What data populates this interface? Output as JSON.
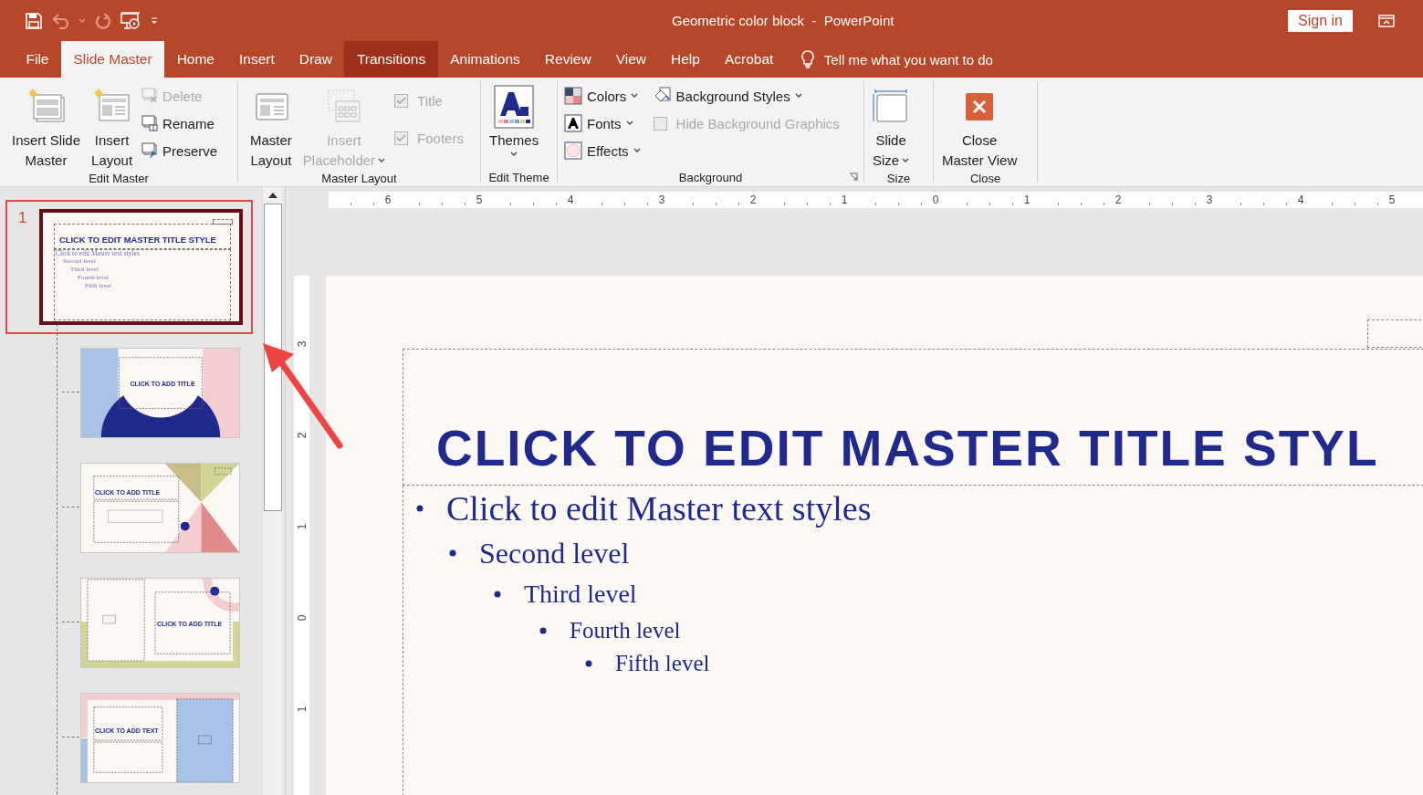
{
  "title_bar": {
    "document_title": "Geometric color block  -  PowerPoint",
    "sign_in": "Sign in"
  },
  "tabs": [
    {
      "label": "File",
      "selected": false,
      "hovered": false
    },
    {
      "label": "Slide Master",
      "selected": true,
      "hovered": false
    },
    {
      "label": "Home",
      "selected": false,
      "hovered": false
    },
    {
      "label": "Insert",
      "selected": false,
      "hovered": false
    },
    {
      "label": "Draw",
      "selected": false,
      "hovered": false
    },
    {
      "label": "Transitions",
      "selected": false,
      "hovered": true
    },
    {
      "label": "Animations",
      "selected": false,
      "hovered": false
    },
    {
      "label": "Review",
      "selected": false,
      "hovered": false
    },
    {
      "label": "View",
      "selected": false,
      "hovered": false
    },
    {
      "label": "Help",
      "selected": false,
      "hovered": false
    },
    {
      "label": "Acrobat",
      "selected": false,
      "hovered": false
    }
  ],
  "tell_me": {
    "label": "Tell me what you want to do"
  },
  "ribbon": {
    "groups": [
      {
        "label": "Edit Master",
        "launcher": false,
        "items": [
          {
            "kind": "large",
            "lines": [
              "Insert Slide",
              "Master"
            ],
            "disabled": false,
            "dropdown": false
          },
          {
            "kind": "large",
            "lines": [
              "Insert",
              "Layout"
            ],
            "disabled": false,
            "dropdown": false
          },
          {
            "kind": "column",
            "items": [
              {
                "kind": "small",
                "label": "Delete",
                "disabled": true,
                "dropdown": false
              },
              {
                "kind": "small",
                "label": "Rename",
                "disabled": false,
                "dropdown": false
              },
              {
                "kind": "small",
                "label": "Preserve",
                "disabled": false,
                "dropdown": false
              }
            ]
          }
        ]
      },
      {
        "label": "Master Layout",
        "launcher": false,
        "items": [
          {
            "kind": "large",
            "lines": [
              "Master",
              "Layout"
            ],
            "disabled": false,
            "dropdown": false
          },
          {
            "kind": "large",
            "lines": [
              "Insert",
              "Placeholder"
            ],
            "disabled": true,
            "dropdown": true
          },
          {
            "kind": "column",
            "items": [
              {
                "kind": "check",
                "label": "Title",
                "disabled": true,
                "checked": true
              },
              {
                "kind": "check",
                "label": "Footers",
                "disabled": true,
                "checked": true
              }
            ]
          }
        ]
      },
      {
        "label": "Edit Theme",
        "launcher": false,
        "items": [
          {
            "kind": "large",
            "lines": [
              "Themes"
            ],
            "disabled": false,
            "dropdown": true
          }
        ]
      },
      {
        "label": "Background",
        "launcher": true,
        "items": [
          {
            "kind": "column",
            "items": [
              {
                "kind": "small",
                "label": "Colors",
                "disabled": false,
                "dropdown": true
              },
              {
                "kind": "small",
                "label": "Fonts",
                "disabled": false,
                "dropdown": true
              },
              {
                "kind": "small",
                "label": "Effects",
                "disabled": false,
                "dropdown": true
              }
            ]
          },
          {
            "kind": "column",
            "items": [
              {
                "kind": "small",
                "label": "Background Styles",
                "disabled": false,
                "dropdown": true
              },
              {
                "kind": "check",
                "label": "Hide Background Graphics",
                "disabled": true,
                "checked": false
              }
            ]
          }
        ]
      },
      {
        "label": "Size",
        "launcher": false,
        "items": [
          {
            "kind": "large",
            "lines": [
              "Slide",
              "Size"
            ],
            "disabled": false,
            "dropdown": true
          }
        ]
      },
      {
        "label": "Close",
        "launcher": false,
        "items": [
          {
            "kind": "large",
            "lines": [
              "Close",
              "Master View"
            ],
            "disabled": false,
            "dropdown": false
          }
        ]
      }
    ]
  },
  "slide_pane": {
    "master": {
      "number": "1",
      "selected": true,
      "title": "CLICK TO EDIT MASTER TITLE STYLE",
      "levels": [
        "Click to edit Master text styles",
        "Second level",
        "Third level",
        "Fourth level",
        "Fifth level"
      ],
      "children": [
        {
          "kind": "circle",
          "title": "CLICK TO ADD TITLE",
          "selected": false
        },
        {
          "kind": "triangles",
          "title": "CLICK TO ADD TITLE",
          "selected": false
        },
        {
          "kind": "ring",
          "title": "CLICK TO ADD TITLE",
          "selected": false
        },
        {
          "kind": "split",
          "title": "CLICK TO ADD TEXT",
          "selected": false
        }
      ]
    }
  },
  "editor": {
    "horizontal_ruler": [
      "6",
      "5",
      "4",
      "3",
      "2",
      "1",
      "0",
      "1",
      "2",
      "3",
      "4",
      "5"
    ],
    "vertical_ruler": [
      "3",
      "2",
      "1",
      "0",
      "1"
    ],
    "slide": {
      "title": "CLICK TO EDIT MASTER TITLE STYL",
      "levels": [
        "Click to edit Master text styles",
        "Second level",
        "Third level",
        "Fourth level",
        "Fifth level"
      ]
    }
  }
}
